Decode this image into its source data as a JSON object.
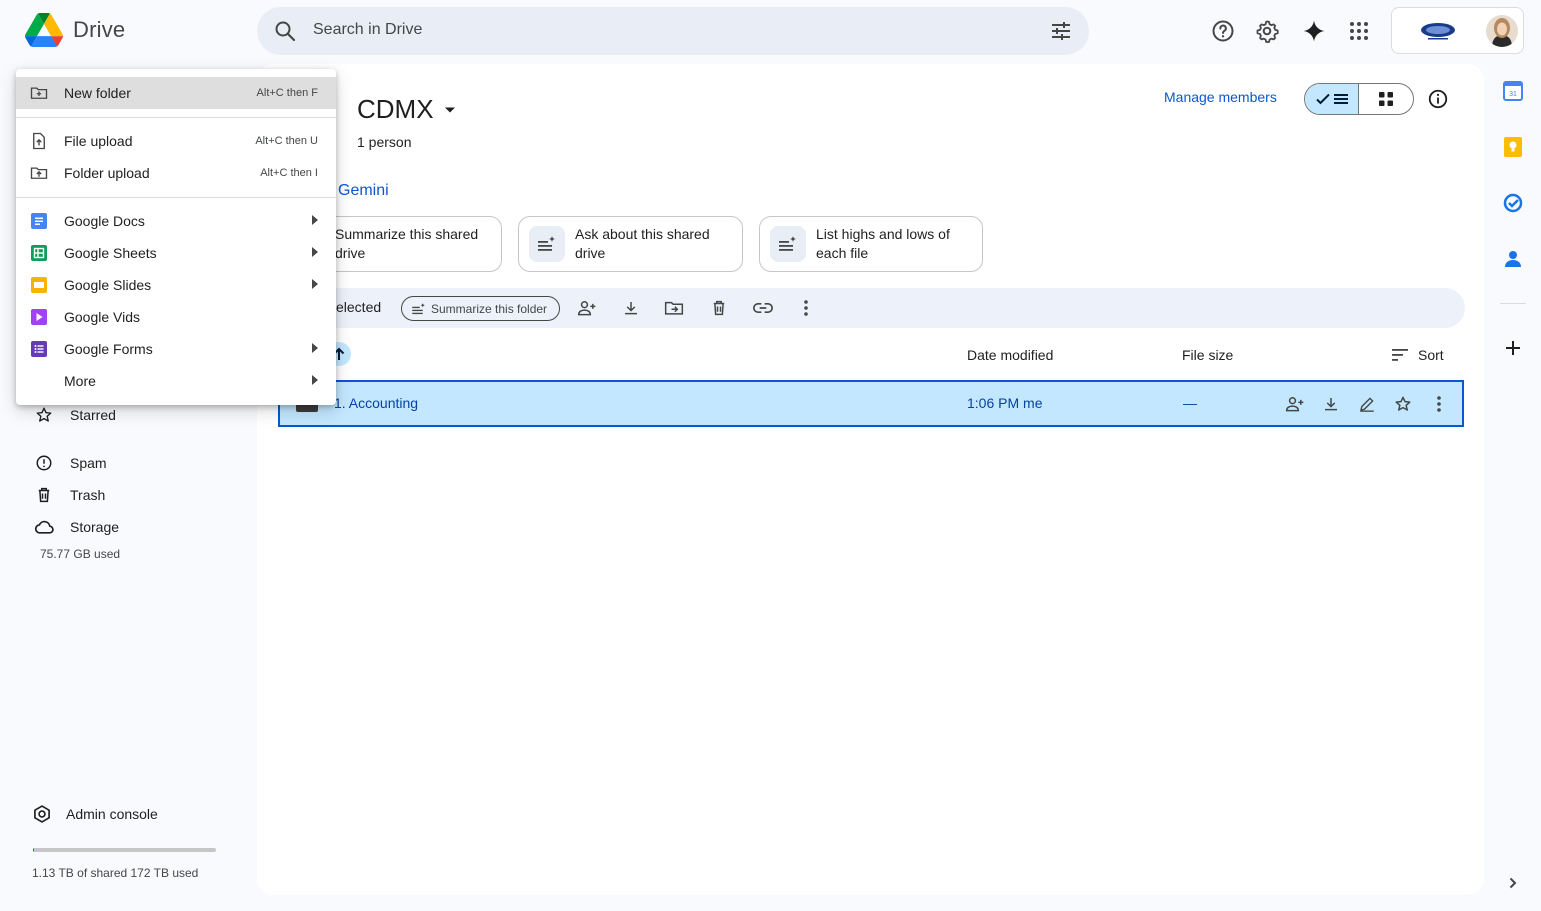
{
  "app": {
    "title": "Drive"
  },
  "search": {
    "placeholder": "Search in Drive"
  },
  "header_icons": [
    "help-icon",
    "settings-icon",
    "gemini-sparkle-icon",
    "apps-grid-icon"
  ],
  "new_menu": {
    "items": [
      {
        "label": "New folder",
        "shortcut": "Alt+C then F"
      },
      {
        "label": "File upload",
        "shortcut": "Alt+C then U"
      },
      {
        "label": "Folder upload",
        "shortcut": "Alt+C then I"
      },
      {
        "label": "Google Docs"
      },
      {
        "label": "Google Sheets"
      },
      {
        "label": "Google Slides"
      },
      {
        "label": "Google Vids"
      },
      {
        "label": "Google Forms"
      },
      {
        "label": "More"
      }
    ]
  },
  "sidebar": {
    "items": [
      {
        "label": "Starred"
      },
      {
        "label": "Spam"
      },
      {
        "label": "Trash"
      },
      {
        "label": "Storage"
      }
    ],
    "storage_used": "75.77 GB used",
    "admin_console": "Admin console",
    "quota_text": "1.13 TB of shared 172 TB used",
    "quota_fraction": 0.0066
  },
  "drive": {
    "name": "CDMX",
    "members": "1 person",
    "manage_members": "Manage members"
  },
  "gemini": {
    "label": "Gemini",
    "chips": [
      {
        "label": "Summarize this shared drive"
      },
      {
        "label": "Ask about this shared drive"
      },
      {
        "label": "List highs and lows of each file"
      }
    ]
  },
  "action_bar": {
    "selected_text": "elected",
    "summarize_folder": "Summarize this folder"
  },
  "table": {
    "columns": {
      "date_modified": "Date modified",
      "file_size": "File size",
      "sort": "Sort"
    },
    "rows": [
      {
        "name": "1. Accounting",
        "date_modified": "1:06 PM me",
        "file_size": "—"
      }
    ]
  },
  "colors": {
    "accent": "#0b57d0",
    "selected_row": "#c2e7ff",
    "background": "#f8fafd"
  }
}
